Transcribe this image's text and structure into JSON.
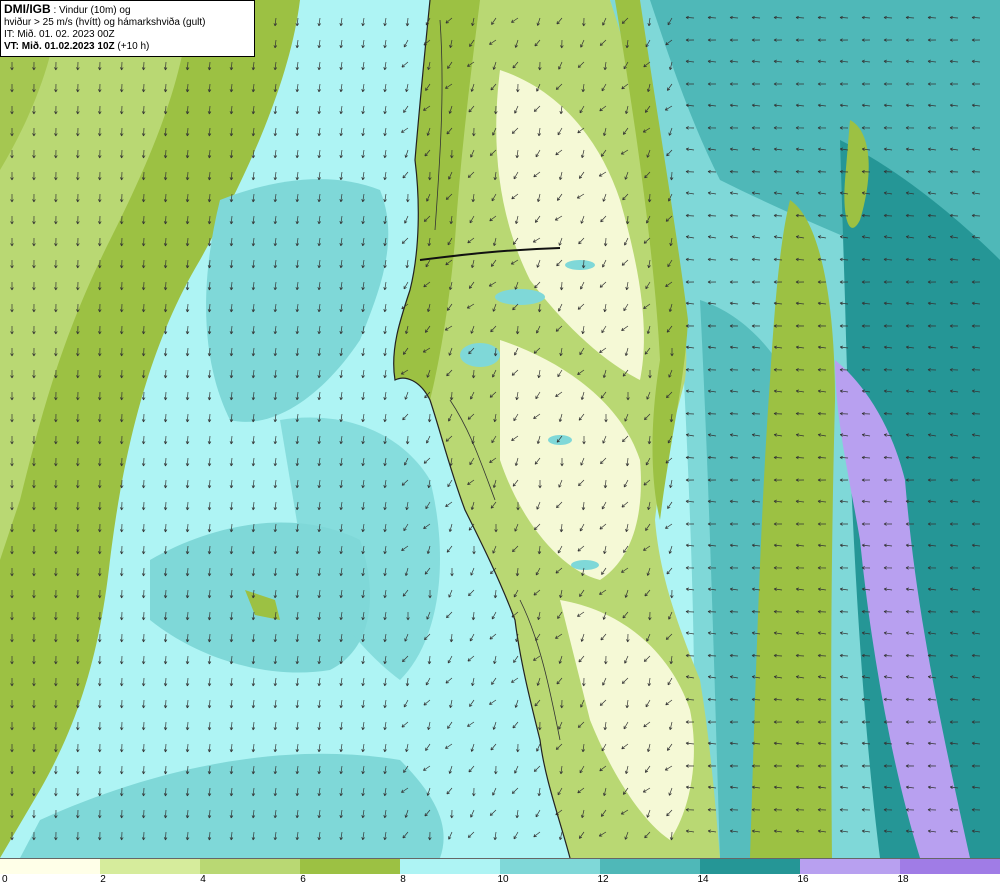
{
  "header": {
    "brand": "DMI/IGB",
    "line1_rest": " : Vindur (10m) og",
    "line2": "hviður > 25 m/s (hvítt) og hámarkshviða (gult)",
    "line3": "IT: Mið. 01. 02. 2023 00Z",
    "line4": "VT: Mið. 01.02.2023 10Z",
    "line4_rest": " (+10 h)"
  },
  "legend": {
    "colors": [
      "#ffffe8",
      "#d6ec9c",
      "#b9d873",
      "#9cc143",
      "#aef4f4",
      "#7fd8d8",
      "#4fb8b8",
      "#259696",
      "#b8a0f0",
      "#a07ce6"
    ],
    "ticks": [
      "0",
      "2",
      "4",
      "6",
      "8",
      "10",
      "12",
      "14",
      "16",
      "18"
    ]
  },
  "map_colors": {
    "land_low": "#9cc143",
    "land_mid": "#b9d873",
    "land_high": "#ffffe8",
    "sea_8": "#aef4f4",
    "sea_10": "#7fd8d8",
    "sea_12": "#4fb8b8",
    "sea_14": "#259696",
    "sea_16": "#b8a0f0",
    "arrow": "#333333"
  }
}
